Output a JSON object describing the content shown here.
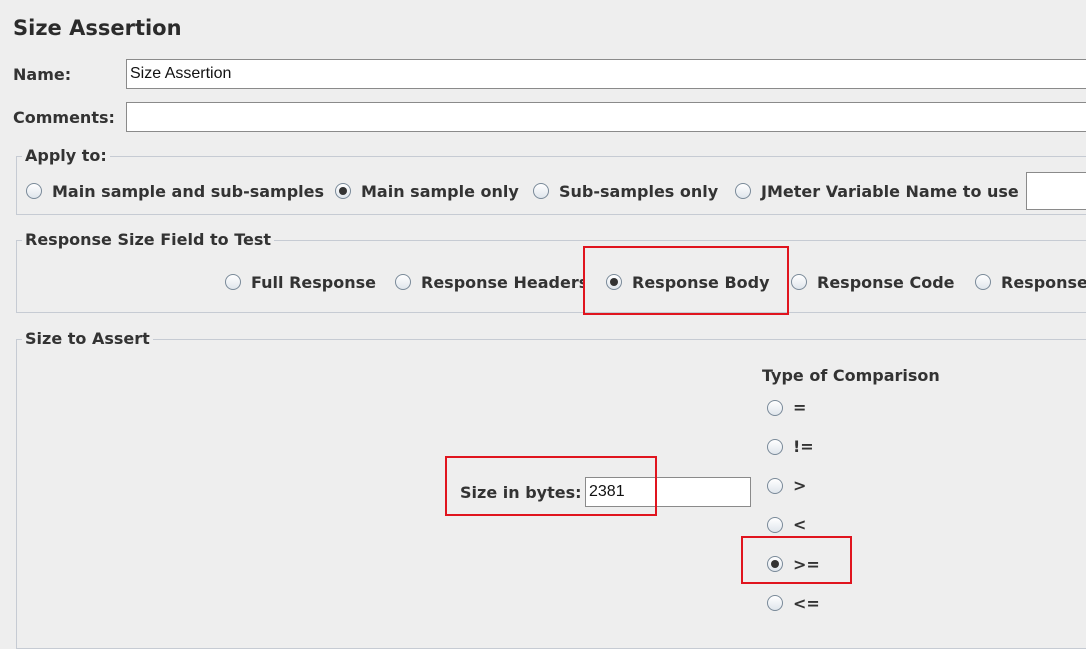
{
  "title": "Size Assertion",
  "name_label": "Name:",
  "name_value": "Size Assertion",
  "comments_label": "Comments:",
  "comments_value": "",
  "apply_to": {
    "legend": "Apply to:",
    "options": [
      {
        "label": "Main sample and sub-samples",
        "selected": false
      },
      {
        "label": "Main sample only",
        "selected": true
      },
      {
        "label": "Sub-samples only",
        "selected": false
      },
      {
        "label": "JMeter Variable Name to use",
        "selected": false
      }
    ],
    "variable_value": ""
  },
  "response_field": {
    "legend": "Response Size Field to Test",
    "options": [
      {
        "label": "Full Response",
        "selected": false
      },
      {
        "label": "Response Headers",
        "selected": false
      },
      {
        "label": "Response Body",
        "selected": true
      },
      {
        "label": "Response Code",
        "selected": false
      },
      {
        "label": "Response",
        "selected": false
      }
    ]
  },
  "size_to_assert": {
    "legend": "Size to Assert",
    "size_label": "Size in bytes:",
    "size_value": "2381",
    "comparison_title": "Type of Comparison",
    "comparisons": [
      {
        "label": "=",
        "selected": false
      },
      {
        "label": "!=",
        "selected": false
      },
      {
        "label": ">",
        "selected": false
      },
      {
        "label": "<",
        "selected": false
      },
      {
        "label": ">=",
        "selected": true
      },
      {
        "label": "<=",
        "selected": false
      }
    ]
  },
  "colors": {
    "background": "#eeeeee",
    "highlight": "#e0141e"
  }
}
